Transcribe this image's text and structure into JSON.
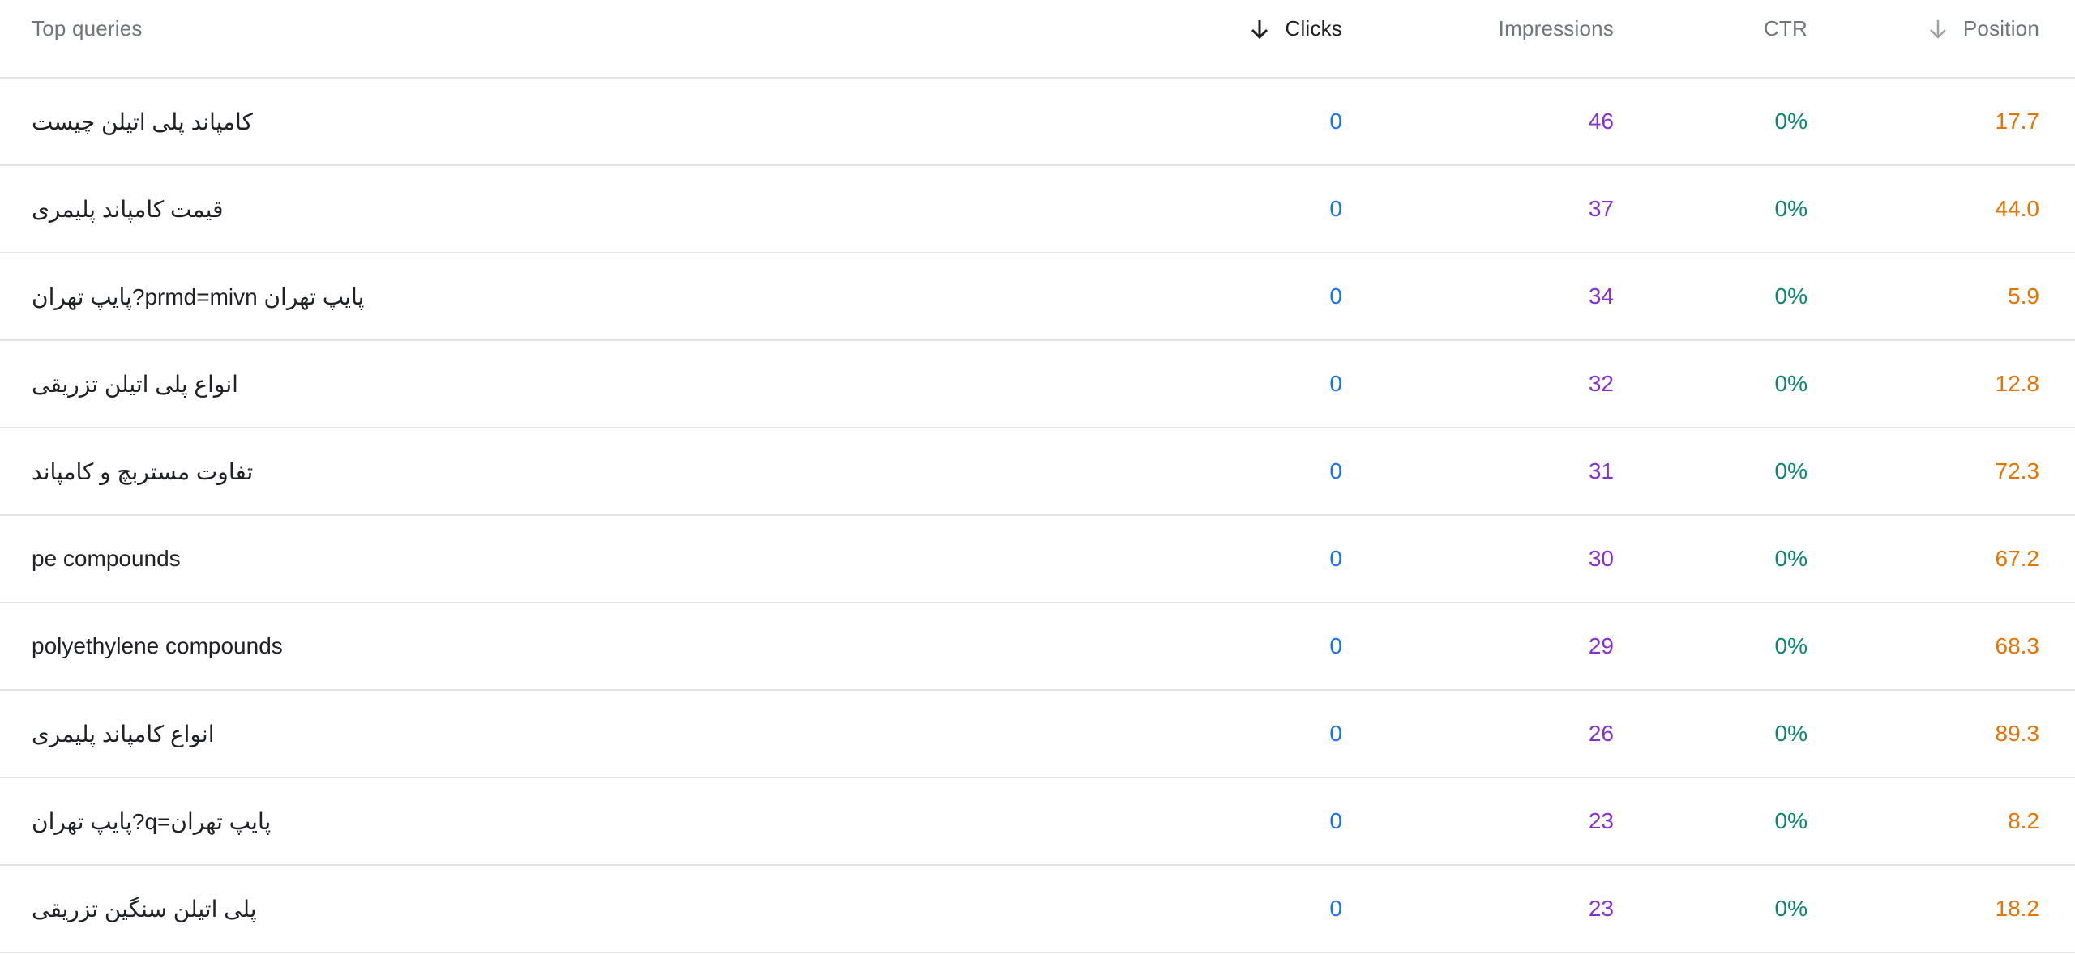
{
  "header": {
    "query_label": "Top queries",
    "clicks_label": "Clicks",
    "impressions_label": "Impressions",
    "ctr_label": "CTR",
    "position_label": "Position"
  },
  "colors": {
    "clicks": "#1a73e8",
    "impressions": "#8430ce",
    "ctr": "#0b8474",
    "position": "#e37400"
  },
  "rows": [
    {
      "query": "کامپاند پلی اتیلن چیست",
      "clicks": "0",
      "impressions": "46",
      "ctr": "0%",
      "position": "17.7"
    },
    {
      "query": "قیمت کامپاند پلیمری",
      "clicks": "0",
      "impressions": "37",
      "ctr": "0%",
      "position": "44.0"
    },
    {
      "query": "پایپ تهران prmd=mivn?پایپ تهران",
      "clicks": "0",
      "impressions": "34",
      "ctr": "0%",
      "position": "5.9"
    },
    {
      "query": "انواع پلی اتیلن تزریقی",
      "clicks": "0",
      "impressions": "32",
      "ctr": "0%",
      "position": "12.8"
    },
    {
      "query": "تفاوت مستربچ و کامپاند",
      "clicks": "0",
      "impressions": "31",
      "ctr": "0%",
      "position": "72.3"
    },
    {
      "query": "pe compounds",
      "clicks": "0",
      "impressions": "30",
      "ctr": "0%",
      "position": "67.2"
    },
    {
      "query": "polyethylene compounds",
      "clicks": "0",
      "impressions": "29",
      "ctr": "0%",
      "position": "68.3"
    },
    {
      "query": "انواع کامپاند پلیمری",
      "clicks": "0",
      "impressions": "26",
      "ctr": "0%",
      "position": "89.3"
    },
    {
      "query": "پایپ تهران=q?پایپ تهران",
      "clicks": "0",
      "impressions": "23",
      "ctr": "0%",
      "position": "8.2"
    },
    {
      "query": "پلی اتیلن سنگین تزریقی",
      "clicks": "0",
      "impressions": "23",
      "ctr": "0%",
      "position": "18.2"
    }
  ]
}
